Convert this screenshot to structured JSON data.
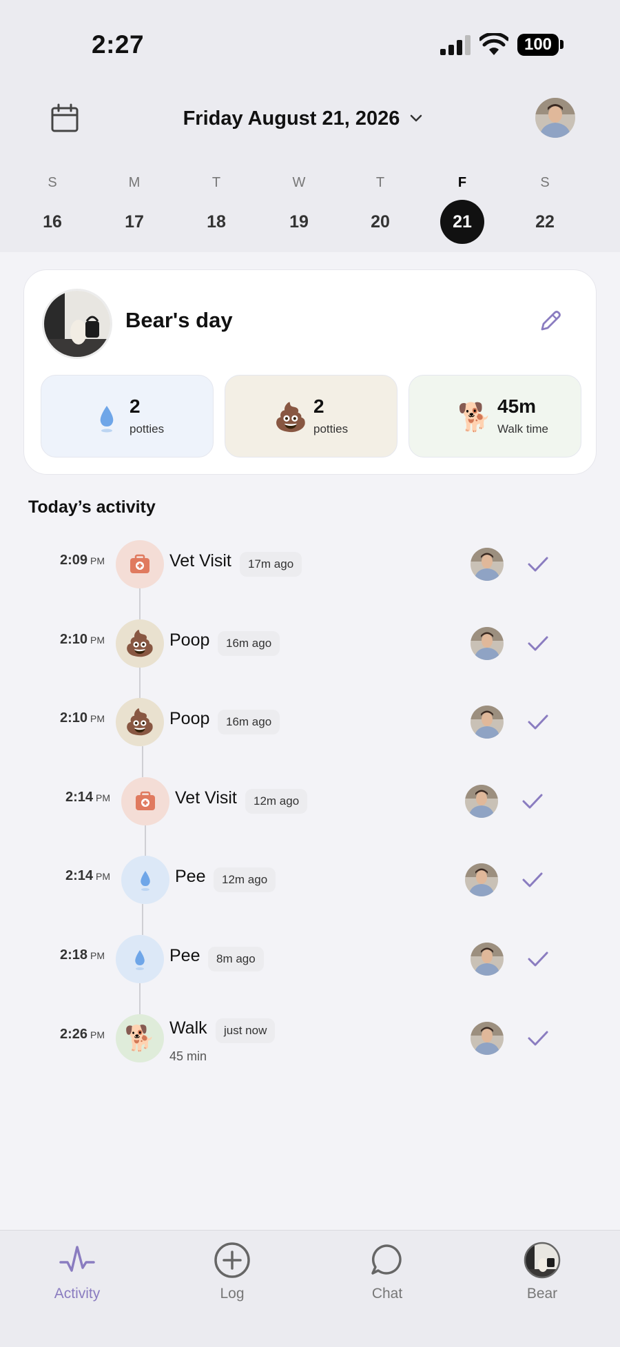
{
  "status_bar": {
    "time": "2:27",
    "battery": "100"
  },
  "header": {
    "date_label": "Friday August 21, 2026",
    "icons": {
      "calendar": "calendar-icon",
      "dropdown": "chevron-down-icon",
      "avatar": "user-avatar"
    }
  },
  "week": [
    {
      "letter": "S",
      "num": "16"
    },
    {
      "letter": "M",
      "num": "17"
    },
    {
      "letter": "T",
      "num": "18"
    },
    {
      "letter": "W",
      "num": "19"
    },
    {
      "letter": "T",
      "num": "20"
    },
    {
      "letter": "F",
      "num": "21",
      "selected": true
    },
    {
      "letter": "S",
      "num": "22"
    }
  ],
  "summary": {
    "title": "Bear's day",
    "stats": [
      {
        "icon": "droplet-icon",
        "value": "2",
        "label": "potties",
        "bg": "#eef3fb"
      },
      {
        "icon": "poop-icon",
        "value": "2",
        "label": "potties",
        "bg": "#f3efe5"
      },
      {
        "icon": "dog-icon",
        "value": "45m",
        "label": "Walk time",
        "bg": "#f1f6ef"
      }
    ]
  },
  "section_title": "Today’s activity",
  "activities": [
    {
      "time": "2:09",
      "ampm": "PM",
      "type": "vet",
      "title": "Vet Visit",
      "ago": "17m ago",
      "sub": ""
    },
    {
      "time": "2:10",
      "ampm": "PM",
      "type": "poop",
      "title": "Poop",
      "ago": "16m ago",
      "sub": ""
    },
    {
      "time": "2:10",
      "ampm": "PM",
      "type": "poop",
      "title": "Poop",
      "ago": "16m ago",
      "sub": ""
    },
    {
      "time": "2:14",
      "ampm": "PM",
      "type": "vet",
      "title": "Vet Visit",
      "ago": "12m ago",
      "sub": ""
    },
    {
      "time": "2:14",
      "ampm": "PM",
      "type": "pee",
      "title": "Pee",
      "ago": "12m ago",
      "sub": ""
    },
    {
      "time": "2:18",
      "ampm": "PM",
      "type": "pee",
      "title": "Pee",
      "ago": "8m ago",
      "sub": ""
    },
    {
      "time": "2:26",
      "ampm": "PM",
      "type": "walk",
      "title": "Walk",
      "ago": "just now",
      "sub": "45 min"
    }
  ],
  "colors": {
    "accent": "#8a7cc0",
    "vet_bg": "#f4ddd6",
    "poop_bg": "#e9e1cf",
    "pee_bg": "#dce8f7",
    "walk_bg": "#dfecda"
  },
  "tabs": [
    {
      "label": "Activity",
      "icon": "activity-icon",
      "active": true
    },
    {
      "label": "Log",
      "icon": "plus-circle-icon",
      "active": false
    },
    {
      "label": "Chat",
      "icon": "chat-bubble-icon",
      "active": false
    },
    {
      "label": "Bear",
      "icon": "dog-avatar",
      "active": false
    }
  ]
}
